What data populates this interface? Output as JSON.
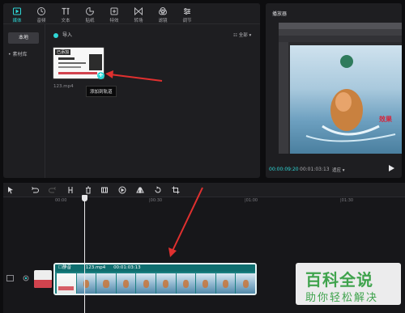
{
  "toolbar": {
    "tools": [
      {
        "label": "媒体",
        "icon": "media-icon"
      },
      {
        "label": "音频",
        "icon": "audio-icon"
      },
      {
        "label": "文本",
        "icon": "text-icon"
      },
      {
        "label": "贴纸",
        "icon": "sticker-icon"
      },
      {
        "label": "特效",
        "icon": "effects-icon"
      },
      {
        "label": "转场",
        "icon": "transition-icon"
      },
      {
        "label": "滤镜",
        "icon": "filter-icon"
      },
      {
        "label": "调节",
        "icon": "adjust-icon"
      }
    ]
  },
  "sidebar": {
    "items": [
      {
        "label": "本地"
      },
      {
        "label": "素材库"
      }
    ]
  },
  "media": {
    "import_label": "导入",
    "sort_label": "全部",
    "thumb_tag": "已添加",
    "file_name": "123.mp4",
    "tooltip": "添加到轨道"
  },
  "player": {
    "title": "播放器",
    "current_time": "00:00:09:20",
    "total_time": "00:01:03:13",
    "ratio_label": "适应",
    "overlay_text": "效果"
  },
  "timeline": {
    "ruler_labels": [
      "00:00",
      "|00:30",
      "|01:00",
      "|01:30"
    ],
    "clip": {
      "mute_label": "静音",
      "name": "123.mp4",
      "duration": "00:01:03:13"
    }
  },
  "watermark": {
    "title": "百科全说",
    "subtitle": "助你轻松解决"
  },
  "colors": {
    "accent": "#2fd7d6",
    "panel": "#1e1e21",
    "clip": "#1a7f80",
    "arrow": "#e0302f",
    "watermark_green": "#3fa34d"
  }
}
